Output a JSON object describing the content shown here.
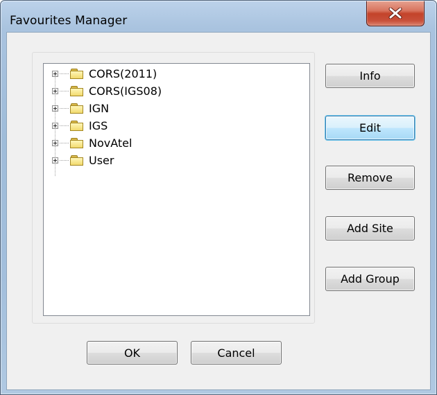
{
  "window": {
    "title": "Favourites Manager"
  },
  "tree": {
    "items": [
      {
        "label": "CORS(2011)"
      },
      {
        "label": "CORS(IGS08)"
      },
      {
        "label": "IGN"
      },
      {
        "label": "IGS"
      },
      {
        "label": "NovAtel"
      },
      {
        "label": "User"
      }
    ]
  },
  "side_buttons": {
    "info": "Info",
    "edit": "Edit",
    "remove": "Remove",
    "add_site": "Add Site",
    "add_group": "Add Group"
  },
  "footer_buttons": {
    "ok": "OK",
    "cancel": "Cancel"
  },
  "icons": {
    "close": "close-icon",
    "folder": "folder-icon",
    "expand": "plus-expander-icon"
  },
  "colors": {
    "close_button": "#c8503a",
    "default_button_border": "#3c7fb1",
    "folder": "#f2da6e"
  }
}
